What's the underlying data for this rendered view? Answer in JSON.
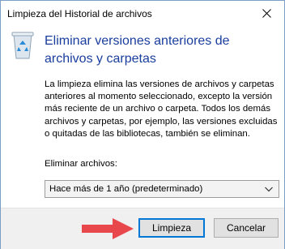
{
  "window": {
    "title": "Limpieza del Historial de archivos"
  },
  "icons": {
    "close": "close-icon",
    "app": "recycle-bin-icon",
    "dropdown": "chevron-down-icon",
    "annotation": "red-arrow-icon"
  },
  "main": {
    "heading": "Eliminar versiones anteriores de archivos y carpetas",
    "description": "La limpieza elimina las versiones de archivos y carpetas anteriores al momento seleccionado, excepto la versión más reciente de un archivo o carpeta. Todos los demás archivos y carpetas, por ejemplo, las versiones excluidas o quitadas de las bibliotecas, también se eliminan.",
    "delete_label": "Eliminar archivos:",
    "select_value": "Hace más de 1 año (predeterminado)"
  },
  "buttons": {
    "cleanup": "Limpieza",
    "cancel": "Cancelar"
  },
  "colors": {
    "heading": "#1a3e9e",
    "primary_border": "#0078d7",
    "arrow": "#e8474c"
  }
}
